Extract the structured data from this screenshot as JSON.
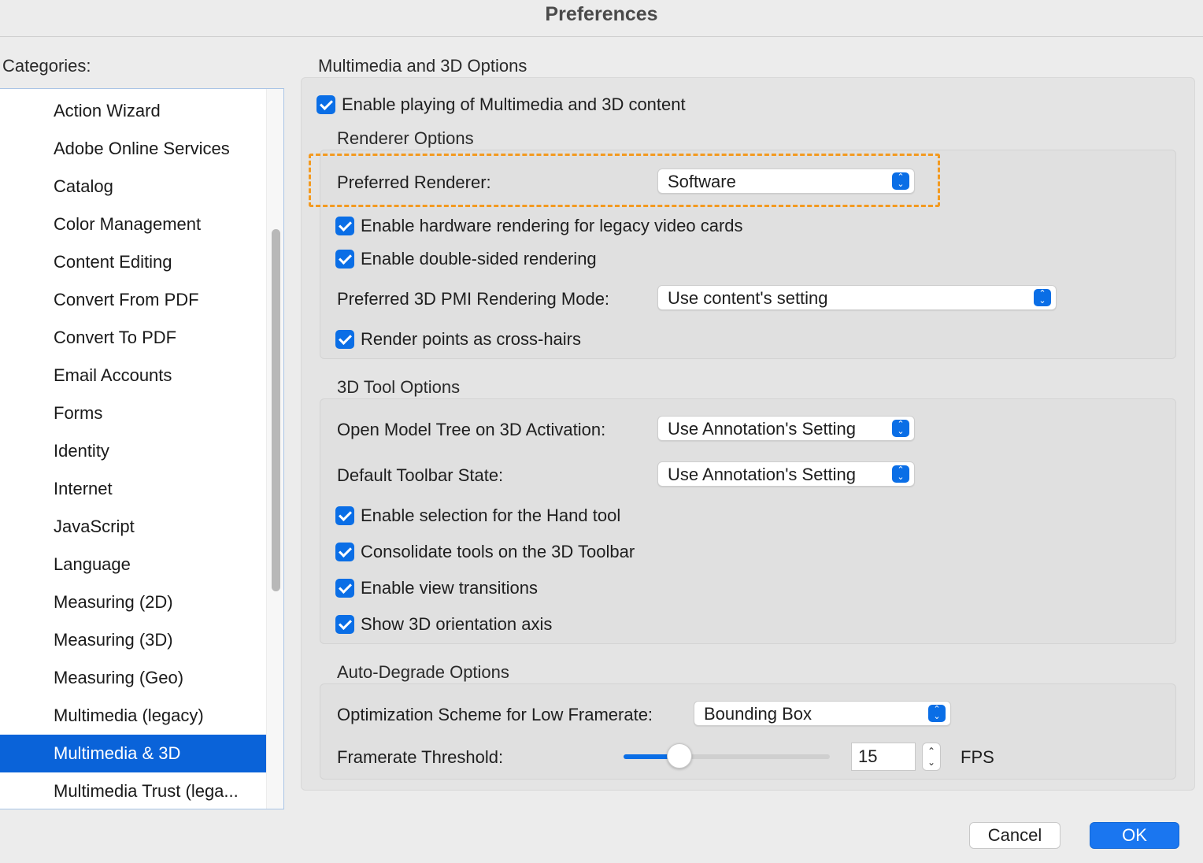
{
  "window": {
    "title": "Preferences"
  },
  "sidebar": {
    "label": "Categories:",
    "items": [
      "Action Wizard",
      "Adobe Online Services",
      "Catalog",
      "Color Management",
      "Content Editing",
      "Convert From PDF",
      "Convert To PDF",
      "Email Accounts",
      "Forms",
      "Identity",
      "Internet",
      "JavaScript",
      "Language",
      "Measuring (2D)",
      "Measuring (3D)",
      "Measuring (Geo)",
      "Multimedia (legacy)",
      "Multimedia & 3D",
      "Multimedia Trust (lega..."
    ],
    "selected_index": 17
  },
  "main": {
    "title": "Multimedia and 3D Options",
    "enable_playing": {
      "label": "Enable playing of Multimedia and 3D content",
      "checked": true
    },
    "renderer": {
      "title": "Renderer Options",
      "preferred_renderer_label": "Preferred Renderer:",
      "preferred_renderer_value": "Software",
      "hw_legacy": {
        "label": "Enable hardware rendering for legacy video cards",
        "checked": true
      },
      "double_sided": {
        "label": "Enable double-sided rendering",
        "checked": true
      },
      "pmi_label": "Preferred 3D PMI Rendering Mode:",
      "pmi_value": "Use content's setting",
      "cross_hairs": {
        "label": "Render points as cross-hairs",
        "checked": true
      }
    },
    "tool": {
      "title": "3D Tool Options",
      "model_tree_label": "Open Model Tree on 3D Activation:",
      "model_tree_value": "Use Annotation's Setting",
      "toolbar_state_label": "Default Toolbar State:",
      "toolbar_state_value": "Use Annotation's Setting",
      "hand_tool": {
        "label": "Enable selection for the Hand tool",
        "checked": true
      },
      "consolidate": {
        "label": "Consolidate tools on the 3D Toolbar",
        "checked": true
      },
      "view_transitions": {
        "label": "Enable view transitions",
        "checked": true
      },
      "orientation_axis": {
        "label": "Show 3D orientation axis",
        "checked": true
      }
    },
    "auto_degrade": {
      "title": "Auto-Degrade Options",
      "scheme_label": "Optimization Scheme for Low Framerate:",
      "scheme_value": "Bounding Box",
      "threshold_label": "Framerate Threshold:",
      "threshold_value": "15",
      "threshold_slider_fraction": 0.27,
      "threshold_unit": "FPS"
    }
  },
  "buttons": {
    "cancel": "Cancel",
    "ok": "OK"
  },
  "colors": {
    "accent": "#0a6ee6",
    "selection": "#0a63d9",
    "highlight": "#f39a20"
  }
}
